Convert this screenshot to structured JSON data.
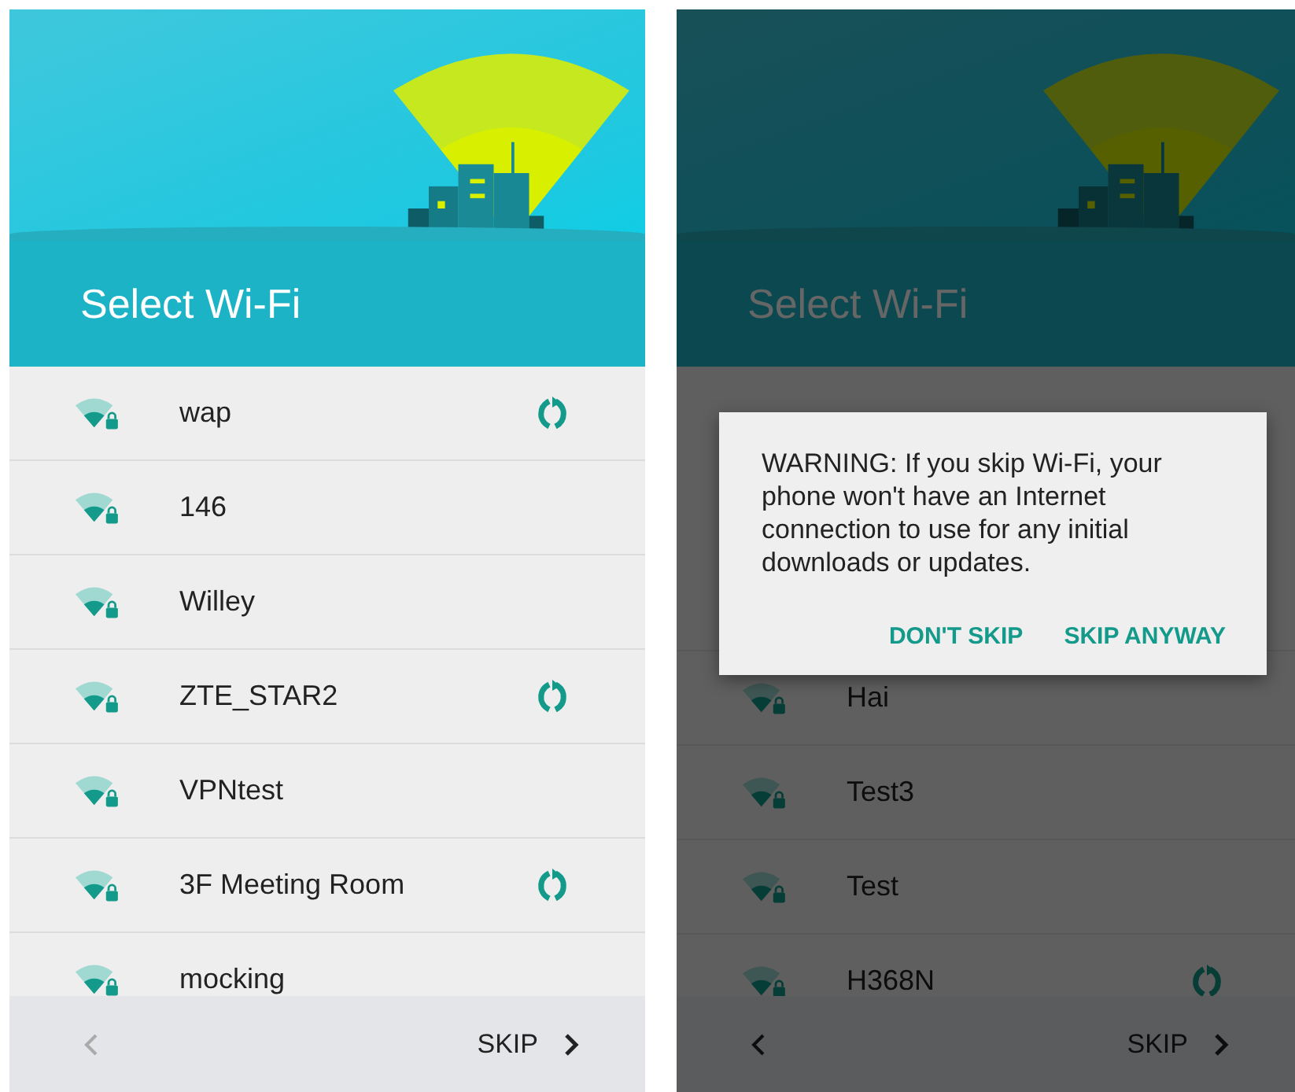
{
  "screens": [
    {
      "title": "Select Wi-Fi",
      "networks": [
        {
          "name": "wap",
          "refresh": true
        },
        {
          "name": "146",
          "refresh": false
        },
        {
          "name": "Willey",
          "refresh": false
        },
        {
          "name": "ZTE_STAR2",
          "refresh": true
        },
        {
          "name": "VPNtest",
          "refresh": false
        },
        {
          "name": "3F Meeting Room",
          "refresh": true
        },
        {
          "name": "mocking",
          "refresh": false
        }
      ],
      "back_disabled": true,
      "skip": "SKIP"
    },
    {
      "title": "Select Wi-Fi",
      "networks": [
        {
          "name": "Hai",
          "refresh": false
        },
        {
          "name": "Test3",
          "refresh": false
        },
        {
          "name": "Test",
          "refresh": false
        },
        {
          "name": "H368N",
          "refresh": true
        }
      ],
      "back_disabled": false,
      "skip": "SKIP",
      "dialog": {
        "message": "WARNING: If you skip Wi-Fi, your phone won't have an Internet connection to use for any initial downloads or updates.",
        "buttons": [
          "DON'T SKIP",
          "SKIP ANYWAY"
        ]
      }
    }
  ]
}
